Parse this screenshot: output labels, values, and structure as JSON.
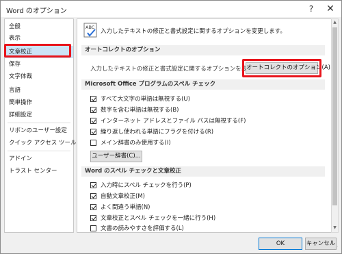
{
  "window": {
    "title": "Word のオプション",
    "help": "?",
    "close": "✕"
  },
  "sidebar": {
    "items": [
      {
        "label": "全般"
      },
      {
        "label": "表示"
      },
      {
        "label": "文章校正"
      },
      {
        "label": "保存"
      },
      {
        "label": "文字体裁"
      },
      {
        "label": "言語"
      },
      {
        "label": "簡単操作"
      },
      {
        "label": "詳細設定"
      },
      {
        "label": "リボンのユーザー設定"
      },
      {
        "label": "クイック アクセス ツール バー"
      },
      {
        "label": "アドイン"
      },
      {
        "label": "トラスト センター"
      }
    ],
    "selected": "文章校正"
  },
  "main": {
    "intro": "入力したテキストの修正と書式設定に関するオプションを変更します。",
    "autocorrect": {
      "header": "オートコレクトのオプション",
      "description": "入力したテキストの修正と書式設定に関するオプションを変更します。",
      "button": "オートコレクトのオプション(A)..."
    },
    "office_spelling": {
      "header": "Microsoft Office プログラムのスペル チェック",
      "options": [
        {
          "label": "すべて大文字の単語は無視する(U)",
          "checked": true
        },
        {
          "label": "数字を含む単語は無視する(B)",
          "checked": true
        },
        {
          "label": "インターネット アドレスとファイル パスは無視する(F)",
          "checked": true
        },
        {
          "label": "繰り返し使われる単語にフラグを付ける(R)",
          "checked": true
        },
        {
          "label": "メイン辞書のみ使用する(I)",
          "checked": false
        }
      ],
      "dict_button": "ユーザー辞書(C)..."
    },
    "word_spelling": {
      "header": "Word のスペル チェックと文章校正",
      "options": [
        {
          "label": "入力時にスペル チェックを行う(P)",
          "checked": true
        },
        {
          "label": "自動文章校正(M)",
          "checked": true
        },
        {
          "label": "よく間違う単語(N)",
          "checked": true
        },
        {
          "label": "文章校正とスペル チェックを一緒に行う(H)",
          "checked": true
        },
        {
          "label": "文書の読みやすさを評価する(L)",
          "checked": false
        }
      ]
    }
  },
  "footer": {
    "ok": "OK",
    "cancel": "キャンセル"
  },
  "colors": {
    "highlight": "#e8141b",
    "selection": "#cce4f7",
    "accent": "#0078d7"
  }
}
